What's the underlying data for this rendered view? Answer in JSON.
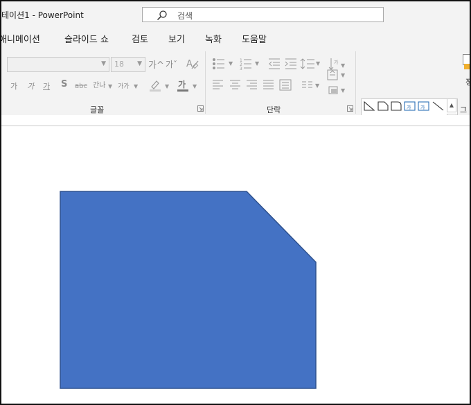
{
  "window": {
    "title": "테이션1  -  PowerPoint"
  },
  "search": {
    "placeholder": "검색"
  },
  "tabs": [
    {
      "label": "애니메이션"
    },
    {
      "label": "슬라이드 쇼"
    },
    {
      "label": "검토"
    },
    {
      "label": "보기"
    },
    {
      "label": "녹화"
    },
    {
      "label": "도움말"
    }
  ],
  "ribbon": {
    "font_group": {
      "label": "글꼴",
      "font_name": "",
      "font_size": "18",
      "grow_font": "가^",
      "shrink_font": "가ˇ",
      "bold": "가",
      "italic": "가",
      "underline": "가",
      "shadow": "S",
      "strikethrough": "ᅟabc",
      "char_spacing": "간나",
      "change_case": "가가",
      "font_color": "가"
    },
    "paragraph_group": {
      "label": "단락"
    },
    "drawing_group": {
      "label": "그리"
    },
    "gallery_more_label": "정"
  },
  "slide": {
    "shape": {
      "type": "snip-corner-rectangle",
      "fill": "#4472c4",
      "stroke": "#2f528f"
    }
  },
  "colors": {
    "accent": "#4472c4",
    "chrome": "#f3f3f3"
  }
}
